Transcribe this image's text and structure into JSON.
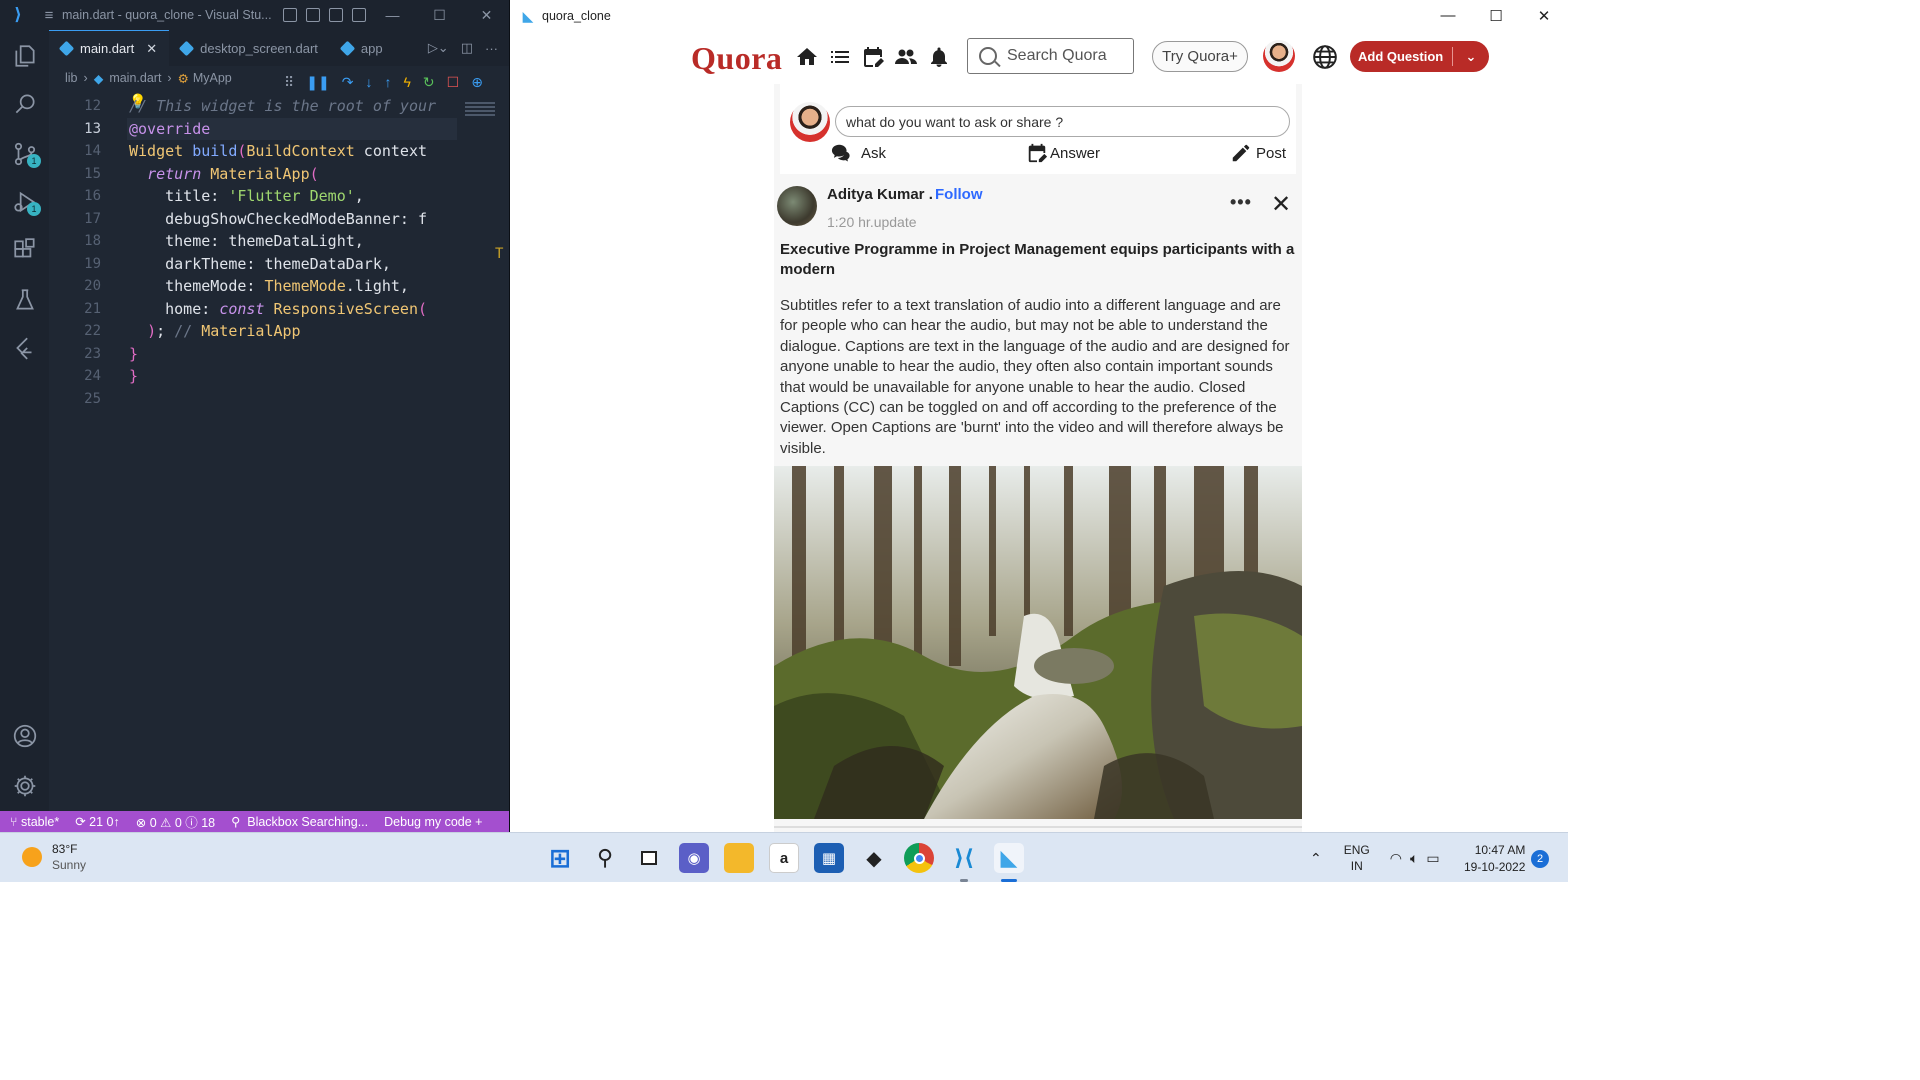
{
  "vscode": {
    "window_title": "main.dart - quora_clone - Visual Stu...",
    "tabs": [
      {
        "label": "main.dart",
        "active": true
      },
      {
        "label": "desktop_screen.dart",
        "active": false
      },
      {
        "label": "app",
        "active": false
      }
    ],
    "breadcrumb": [
      "lib",
      "main.dart",
      "MyApp"
    ],
    "activity_badges": {
      "source_control": "1",
      "run_debug": "1"
    },
    "code_lines": [
      {
        "num": "12",
        "text": "// This widget is the root of your"
      },
      {
        "num": "13",
        "text": "@override"
      },
      {
        "num": "14",
        "text": "Widget build(BuildContext context"
      },
      {
        "num": "15",
        "text": "  return MaterialApp("
      },
      {
        "num": "16",
        "text": "    title: 'Flutter Demo',"
      },
      {
        "num": "17",
        "text": "    debugShowCheckedModeBanner: f"
      },
      {
        "num": "18",
        "text": "    theme: themeDataLight,"
      },
      {
        "num": "19",
        "text": "    darkTheme: themeDataDark,"
      },
      {
        "num": "20",
        "text": "    themeMode: ThemeMode.light,"
      },
      {
        "num": "21",
        "text": "    home: const ResponsiveScreen("
      },
      {
        "num": "22",
        "text": "  ); // MaterialApp"
      },
      {
        "num": "23",
        "text": "}"
      },
      {
        "num": "24",
        "text": "}"
      },
      {
        "num": "25",
        "text": ""
      }
    ],
    "current_line": "13",
    "status": {
      "branch": "stable*",
      "sync": "21 0↑",
      "problems": "⊗ 0 ⚠ 0 ⓘ 18",
      "blackbox": "Blackbox Searching...",
      "debug": "Debug my code +"
    }
  },
  "app": {
    "window_title": "quora_clone",
    "logo": "Quora",
    "nav_icons": [
      "home-icon",
      "list-icon",
      "edit-calendar-icon",
      "people-icon",
      "bell-icon"
    ],
    "search_placeholder": "Search Quora",
    "try_button": "Try Quora+",
    "add_question": "Add Question",
    "ask_box": {
      "placeholder": "what do you want to ask or share ?",
      "actions": [
        {
          "label": "Ask",
          "icon": "chat-icon"
        },
        {
          "label": "Answer",
          "icon": "edit-calendar-icon"
        },
        {
          "label": "Post",
          "icon": "pencil-icon"
        }
      ]
    },
    "post": {
      "author": "Aditya Kumar .",
      "follow": "Follow",
      "time": "1:20 hr.update",
      "title": "Executive Programme in Project Management equips participants with a modern",
      "body": "Subtitles refer to a text translation of audio into a different language and are for people who can hear the audio, but may not be able to understand the dialogue. Captions are text in the language of the audio and are designed for anyone unable to hear the audio, they often also contain important sounds that would be unavailable for anyone unable to hear the audio. Closed Captions (CC) can be toggled on and off according to the preference of the viewer. Open Captions are 'burnt' into the video and will therefore always be visible."
    },
    "colors": {
      "brand": "#b92b27",
      "follow": "#2e69ff"
    }
  },
  "taskbar": {
    "weather_temp": "83°F",
    "weather_cond": "Sunny",
    "apps": [
      "windows-start-icon",
      "search-icon",
      "task-view-icon",
      "teams-chat-icon",
      "file-explorer-icon",
      "amazon-icon",
      "microsoft-store-icon",
      "dropbox-icon",
      "chrome-icon",
      "vscode-icon",
      "flutter-icon"
    ],
    "lang_1": "ENG",
    "lang_2": "IN",
    "time": "10:47 AM",
    "date": "19-10-2022",
    "notifications": "2"
  }
}
